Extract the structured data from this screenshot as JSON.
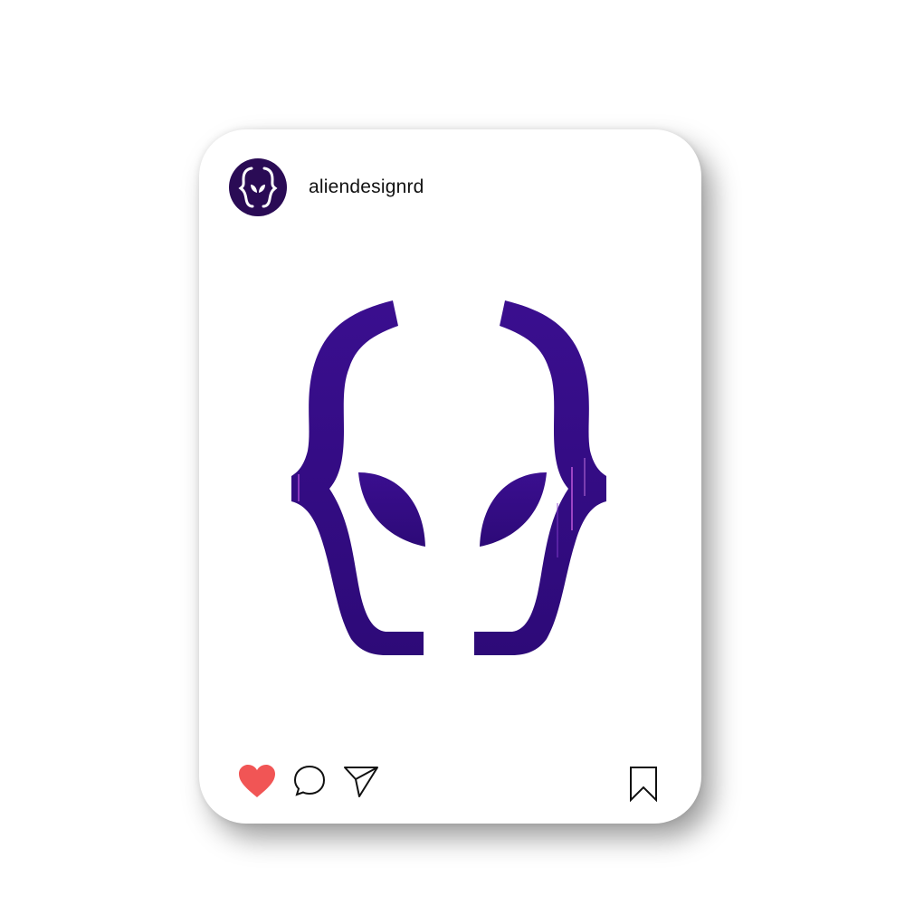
{
  "post": {
    "username": "aliendesignrd",
    "avatar_icon": "alien-logo-icon",
    "image_icon": "alien-bracket-logo",
    "brand_color": "#3a0a8a",
    "avatar_bg": "#2a0b55"
  },
  "actions": {
    "like_icon": "heart-icon",
    "like_color": "#f15555",
    "liked": true,
    "comment_icon": "comment-icon",
    "share_icon": "send-icon",
    "save_icon": "bookmark-icon"
  }
}
